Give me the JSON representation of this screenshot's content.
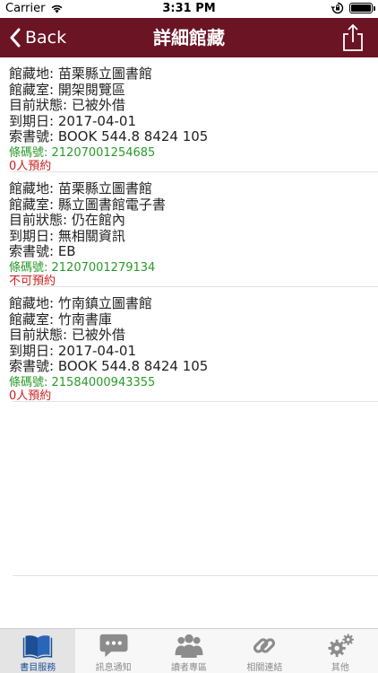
{
  "status_bar": {
    "carrier": "Carrier",
    "time": "3:31 PM"
  },
  "nav": {
    "back_label": "Back",
    "title": "詳細館藏"
  },
  "records": [
    {
      "location": "館藏地:  苗栗縣立圖書館",
      "room": "館藏室:  開架閱覽區",
      "status": "目前狀態:  已被外借",
      "due": "到期日:   2017-04-01",
      "callno": "索書號:   BOOK 544.8 8424  105",
      "barcode": "條碼號:  21207001254685",
      "reserve": "0人預約"
    },
    {
      "location": "館藏地:  苗栗縣立圖書館",
      "room": "館藏室:  縣立圖書館電子書",
      "status": "目前狀態:  仍在館內",
      "due": "到期日:  無相關資訊",
      "callno": "索書號:   EB",
      "barcode": "條碼號:  21207001279134",
      "reserve": "不可預約"
    },
    {
      "location": "館藏地:  竹南鎮立圖書館",
      "room": "館藏室:  竹南書庫",
      "status": "目前狀態:  已被外借",
      "due": "到期日:   2017-04-01",
      "callno": "索書號:   BOOK 544.8 8424  105",
      "barcode": "條碼號:  21584000943355",
      "reserve": "0人預約"
    }
  ],
  "tabs": [
    {
      "label": "書目服務",
      "icon": "book-icon",
      "active": true
    },
    {
      "label": "訊息通知",
      "icon": "chat-bubble-icon",
      "active": false
    },
    {
      "label": "讀者專區",
      "icon": "users-icon",
      "active": false
    },
    {
      "label": "相關連結",
      "icon": "link-icon",
      "active": false
    },
    {
      "label": "其他",
      "icon": "gears-icon",
      "active": false
    }
  ],
  "colors": {
    "nav_bg": "#6b1424",
    "barcode": "#2a9a2a",
    "reserve": "#cc1f1f",
    "tab_active": "#1b4f96",
    "tab_inactive": "#8c8c8c"
  }
}
